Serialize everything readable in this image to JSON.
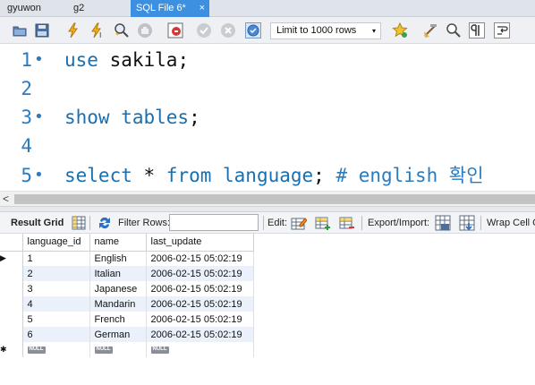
{
  "tabs": [
    {
      "label": "gyuwon",
      "active": false
    },
    {
      "label": "g2",
      "active": false
    },
    {
      "label": "SQL File 6*",
      "active": true,
      "close": "×"
    }
  ],
  "toolbar": {
    "icons": [
      "open-file-icon",
      "save-icon",
      "execute-lightning-icon",
      "execute-current-lightning-icon",
      "explain-magnifier-icon",
      "stop-hand-icon",
      "toggle-error-icon",
      "commit-icon",
      "rollback-icon",
      "autocommit-icon",
      "add-snippet-star-icon",
      "beautify-broom-icon",
      "find-icon",
      "invisible-chars-icon",
      "wrap-text-icon"
    ],
    "limit_label": "Limit to 1000 rows",
    "limit_arrow": "▾"
  },
  "editor": {
    "lines": [
      {
        "num": "1",
        "bullet": "•",
        "keyword": "use",
        "rest": " sakila;",
        "comment": ""
      },
      {
        "num": "2",
        "bullet": "",
        "keyword": "",
        "rest": "",
        "comment": ""
      },
      {
        "num": "3",
        "bullet": "•",
        "keyword": "show tables",
        "rest": ";",
        "comment": ""
      },
      {
        "num": "4",
        "bullet": "",
        "keyword": "",
        "rest": "",
        "comment": ""
      },
      {
        "num": "5",
        "bullet": "•",
        "keyword": "select",
        "rest": "",
        "comment": "# english 확인"
      }
    ],
    "line5": {
      "star": " * ",
      "from": "from",
      "table": " language",
      "semi": "; "
    }
  },
  "scrollbar": {
    "left_arrow": "<"
  },
  "result_toolbar": {
    "result_grid_label": "Result Grid",
    "filter_label": "Filter Rows:",
    "filter_value": "",
    "edit_label": "Edit:",
    "export_label": "Export/Import:",
    "wrap_label": "Wrap Cell C"
  },
  "grid": {
    "columns": [
      "language_id",
      "name",
      "last_update"
    ],
    "rows": [
      [
        "1",
        "English",
        "2006-02-15 05:02:19"
      ],
      [
        "2",
        "Italian",
        "2006-02-15 05:02:19"
      ],
      [
        "3",
        "Japanese",
        "2006-02-15 05:02:19"
      ],
      [
        "4",
        "Mandarin",
        "2006-02-15 05:02:19"
      ],
      [
        "5",
        "French",
        "2006-02-15 05:02:19"
      ],
      [
        "6",
        "German",
        "2006-02-15 05:02:19"
      ]
    ],
    "null_label": "NULL",
    "current_row_marker": "▶",
    "new_row_marker": "✱"
  }
}
